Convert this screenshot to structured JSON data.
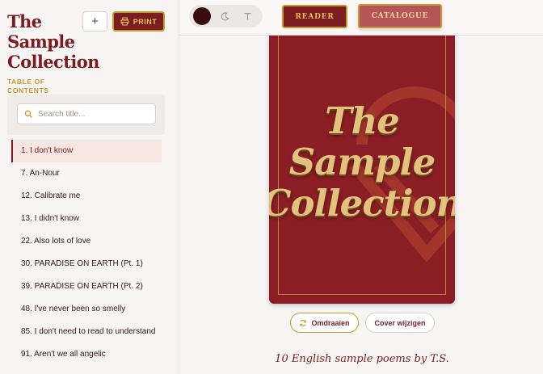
{
  "sidebar": {
    "book_title": "The Sample Collection",
    "toc_label": "TABLE OF CONTENTS",
    "add_label": "+",
    "print_label": "PRINT",
    "search_placeholder": "Search title...",
    "items": [
      {
        "label": "1. I don't know",
        "active": true
      },
      {
        "label": "7. An-Nour"
      },
      {
        "label": "12. Calibrate me"
      },
      {
        "label": "13. I didn't know"
      },
      {
        "label": "22. Also lots of love"
      },
      {
        "label": "30. PARADISE ON EARTH (Pt. 1)"
      },
      {
        "label": "39. PARADISE ON EARTH (Pt. 2)"
      },
      {
        "label": "48. I've never been so smelly"
      },
      {
        "label": "85. I don't need to read to understand"
      },
      {
        "label": "91. Aren't we all angelic"
      }
    ]
  },
  "topbar": {
    "modes": [
      "dark-mode-dot",
      "moon-icon",
      "text-icon"
    ],
    "reader_label": "READER",
    "catalogue_label": "CATALOGUE"
  },
  "cover": {
    "title": "The\nSample\nCollection",
    "rotate_label": "Omdraaien",
    "change_label": "Cover wijzigen",
    "subtitle": "10 English sample poems by T.S."
  },
  "colors": {
    "accent": "#7a1c20",
    "gold": "#c79a2c",
    "cover_bg": "#8b1e24"
  }
}
